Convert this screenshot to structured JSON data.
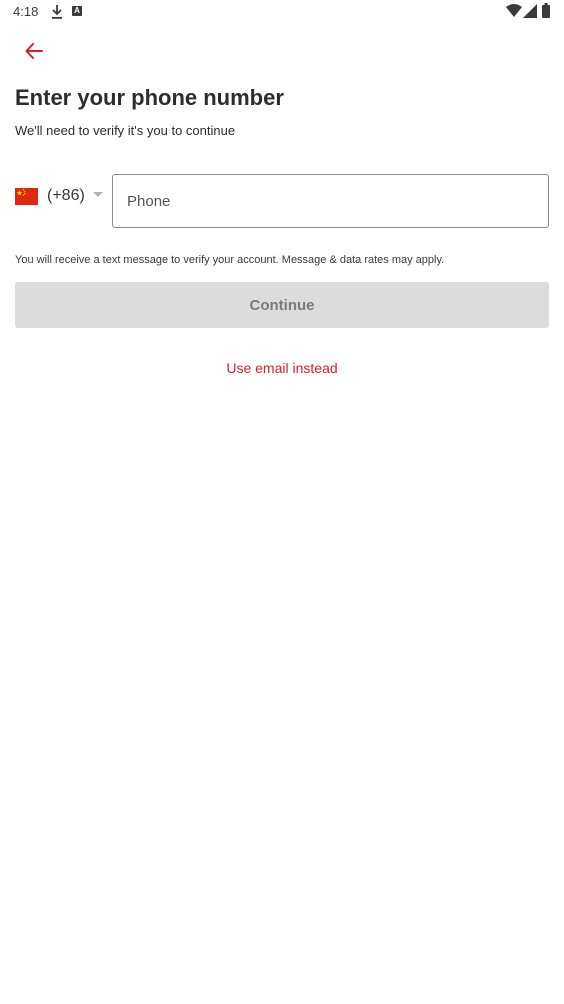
{
  "status_bar": {
    "time": "4:18",
    "app_badge": "A"
  },
  "header": {
    "title": "Enter your phone number",
    "subtitle": "We'll need to verify it's you to continue"
  },
  "phone_form": {
    "country_code": "(+86)",
    "country_flag": "China",
    "phone_placeholder": "Phone",
    "phone_value": "",
    "disclaimer": "You will receive a text message to verify your account. Message & data rates may apply.",
    "continue_label": "Continue",
    "alt_link_label": "Use email instead"
  },
  "colors": {
    "accent": "#d6202f",
    "button_disabled_bg": "#dcdcdc",
    "button_disabled_text": "#7a7a7a"
  }
}
